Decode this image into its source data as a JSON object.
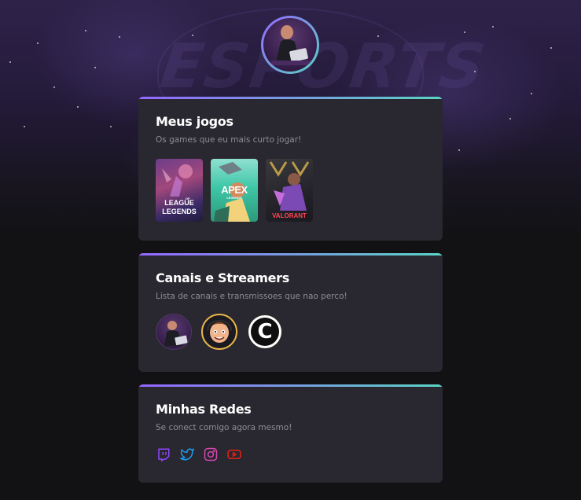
{
  "profile": {
    "avatar_icon": "user-avatar-icon"
  },
  "colors": {
    "gradient_start": "#9466ff",
    "gradient_end": "#5ad4c5",
    "card_bg": "#29272f",
    "page_bg": "#121214"
  },
  "background": {
    "logo_text": "ESPORTS"
  },
  "games_card": {
    "title": "Meus jogos",
    "subtitle": "Os games que eu mais curto jogar!",
    "games": [
      {
        "name": "League of Legends",
        "art_line1": "LEAGUE",
        "art_line2": "LEGENDS",
        "art_small": "OF"
      },
      {
        "name": "Apex Legends",
        "art_line1": "APEX",
        "art_line2": "LEGENDS"
      },
      {
        "name": "Valorant",
        "art_line1": "VALORANT"
      }
    ]
  },
  "streamers_card": {
    "title": "Canais e Streamers",
    "subtitle": "Lista de canais e transmissoes que nao perco!",
    "streamers": [
      {
        "icon": "streamer-avatar-icon"
      },
      {
        "icon": "cartoon-streamer-avatar-icon"
      },
      {
        "icon": "channel-logo-icon",
        "letter": "C"
      }
    ]
  },
  "socials_card": {
    "title": "Minhas Redes",
    "subtitle": "Se conect comigo agora mesmo!",
    "links": [
      {
        "icon": "twitch-icon",
        "color": "#9146ff"
      },
      {
        "icon": "twitter-icon",
        "color": "#1d9bf0"
      },
      {
        "icon": "instagram-icon",
        "color": "#d946b3"
      },
      {
        "icon": "youtube-icon",
        "color": "#e62117"
      }
    ]
  }
}
